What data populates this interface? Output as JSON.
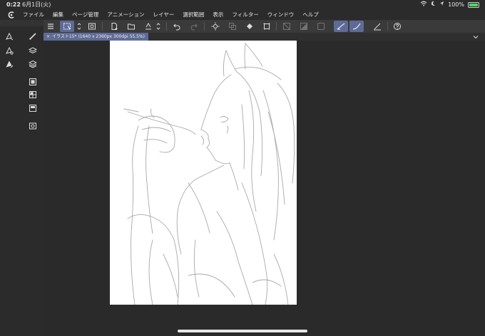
{
  "status_bar": {
    "time": "0:22",
    "date": "6月1日(火)",
    "battery": "100%"
  },
  "menu": {
    "app_icon": "clip-studio-icon",
    "items": [
      "ファイル",
      "編集",
      "ページ管理",
      "アニメーション",
      "レイヤー",
      "選択範囲",
      "表示",
      "フィルター",
      "ウィンドウ",
      "ヘルプ"
    ]
  },
  "document_tab": {
    "close": "×",
    "title": "イラスト15* (1640 x 2360px 300dpi 55.5%)"
  },
  "colors": {
    "background": "#2a2a2a",
    "toolbar": "#3a3a3a",
    "accent": "#5e6b96",
    "paper": "#ffffff",
    "battery": "#4cd964"
  }
}
